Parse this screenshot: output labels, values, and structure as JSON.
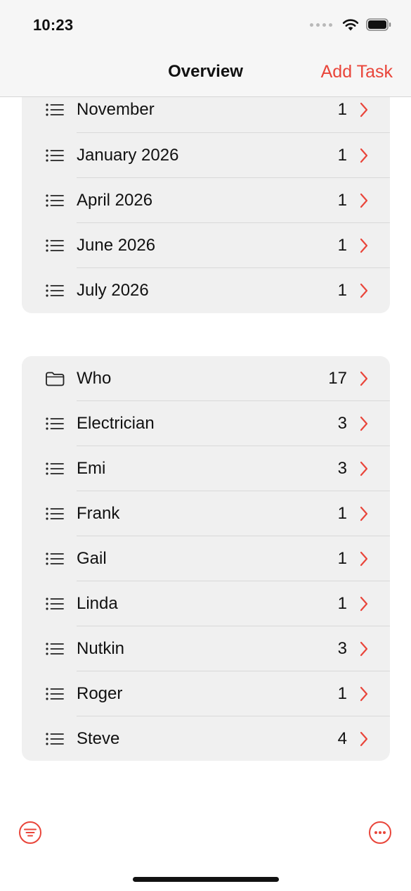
{
  "status_bar": {
    "time": "10:23"
  },
  "nav": {
    "title": "Overview",
    "add_task_label": "Add Task"
  },
  "colors": {
    "accent": "#e9453a",
    "group_background": "#f0f0f0"
  },
  "group_dates": {
    "items": [
      {
        "label": "November",
        "count": "1",
        "icon": "list-icon"
      },
      {
        "label": "January 2026",
        "count": "1",
        "icon": "list-icon"
      },
      {
        "label": "April 2026",
        "count": "1",
        "icon": "list-icon"
      },
      {
        "label": "June 2026",
        "count": "1",
        "icon": "list-icon"
      },
      {
        "label": "July 2026",
        "count": "1",
        "icon": "list-icon"
      }
    ]
  },
  "group_people": {
    "items": [
      {
        "label": "Who",
        "count": "17",
        "icon": "folder-icon"
      },
      {
        "label": "Electrician",
        "count": "3",
        "icon": "list-icon"
      },
      {
        "label": "Emi",
        "count": "3",
        "icon": "list-icon"
      },
      {
        "label": "Frank",
        "count": "1",
        "icon": "list-icon"
      },
      {
        "label": "Gail",
        "count": "1",
        "icon": "list-icon"
      },
      {
        "label": "Linda",
        "count": "1",
        "icon": "list-icon"
      },
      {
        "label": "Nutkin",
        "count": "3",
        "icon": "list-icon"
      },
      {
        "label": "Roger",
        "count": "1",
        "icon": "list-icon"
      },
      {
        "label": "Steve",
        "count": "4",
        "icon": "list-icon"
      }
    ]
  },
  "toolbar": {
    "left_icon": "filter-icon",
    "right_icon": "more-icon"
  }
}
